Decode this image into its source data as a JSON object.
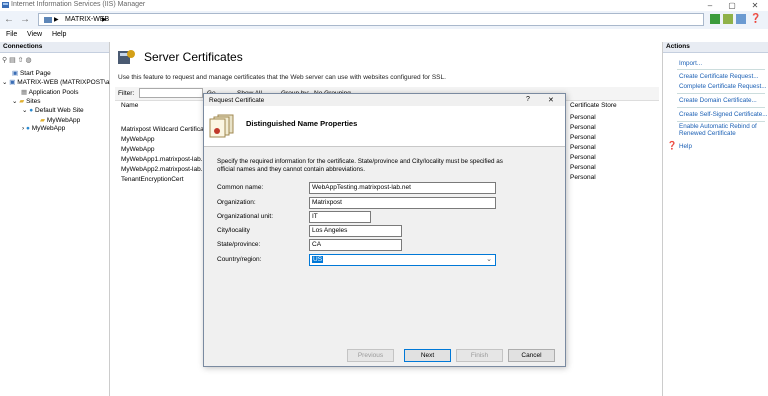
{
  "window": {
    "title": "Internet Information Services (IIS) Manager",
    "min": "–",
    "max": "▢",
    "close": "✕"
  },
  "address": {
    "crumbs": [
      "MATRIX-WEB"
    ]
  },
  "menu": [
    "File",
    "View",
    "Help"
  ],
  "connections": {
    "title": "Connections",
    "items": [
      "Start Page",
      "MATRIX-WEB (MATRIXPOST\\a",
      "Application Pools",
      "Sites",
      "Default Web Site",
      "MyWebApp",
      "MyWebApp"
    ]
  },
  "main": {
    "title": "Server Certificates",
    "description": "Use this feature to request and manage certificates that the Web server can use with websites configured for SSL.",
    "filter_label": "Filter:",
    "filter_go": "Go",
    "show_all": "Show All",
    "group_by": "Group by:",
    "group_value": "No Grouping",
    "columns": [
      "Name",
      "Certificate Store"
    ],
    "rows": [
      {
        "name": "Matrixpost Wildcard Certificat",
        "store": "Personal"
      },
      {
        "name": "MyWebApp",
        "store": "Personal"
      },
      {
        "name": "MyWebApp",
        "store": "Personal"
      },
      {
        "name": "MyWebApp1.matrixpost-lab.",
        "store": "Personal"
      },
      {
        "name": "MyWebApp2.matrixpost-lab.",
        "store": "Personal"
      },
      {
        "name": "TenantEncryptionCert",
        "store": "Personal"
      }
    ],
    "first_store": "Personal"
  },
  "actions": {
    "title": "Actions",
    "items": [
      "Import...",
      "Create Certificate Request...",
      "Complete Certificate Request...",
      "Create Domain Certificate...",
      "Create Self-Signed Certificate...",
      "Enable Automatic Rebind of",
      "Renewed Certificate",
      "Help"
    ]
  },
  "dialog": {
    "title": "Request Certificate",
    "help": "?",
    "close": "✕",
    "heading": "Distinguished Name Properties",
    "instructions": "Specify the required information for the certificate. State/province and City/locality must be specified as official names and they cannot contain abbreviations.",
    "fields": [
      {
        "label": "Common name:",
        "value": "WebAppTesting.matrixpost-lab.net"
      },
      {
        "label": "Organization:",
        "value": "Matrixpost"
      },
      {
        "label": "Organizational unit:",
        "value": "IT"
      },
      {
        "label": "City/locality",
        "value": "Los Angeles"
      },
      {
        "label": "State/province:",
        "value": "CA"
      },
      {
        "label": "Country/region:",
        "value": "US"
      }
    ],
    "buttons": {
      "previous": "Previous",
      "next": "Next",
      "finish": "Finish",
      "cancel": "Cancel"
    }
  }
}
